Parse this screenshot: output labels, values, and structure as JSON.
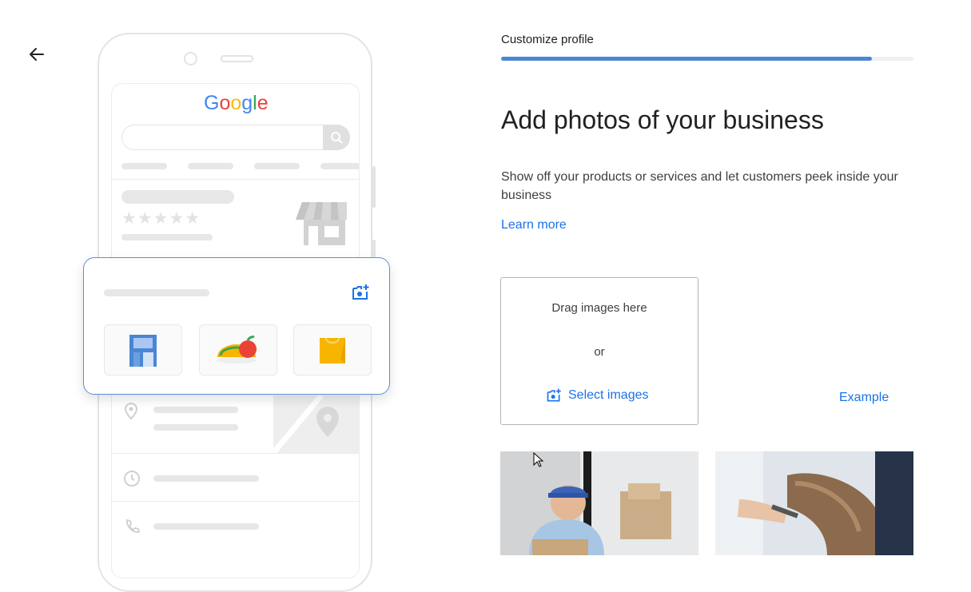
{
  "nav": {
    "back_icon": "arrow-left-icon"
  },
  "illustration": {
    "logo_letters": [
      {
        "ch": "G",
        "color": "#4285F4"
      },
      {
        "ch": "o",
        "color": "#EA4335"
      },
      {
        "ch": "o",
        "color": "#FBBC05"
      },
      {
        "ch": "g",
        "color": "#4285F4"
      },
      {
        "ch": "l",
        "color": "#34A853"
      },
      {
        "ch": "e",
        "color": "#EA4335"
      }
    ],
    "stars": "★★★★★"
  },
  "header": {
    "step_label": "Customize profile",
    "progress_fraction": 0.9
  },
  "main": {
    "title": "Add photos of your business",
    "description": "Show off your products or services and let customers peek inside your business",
    "learn_more": "Learn more"
  },
  "dropzone": {
    "drag_text": "Drag images here",
    "or_text": "or",
    "select_label": "Select images",
    "select_icon": "add-photo-icon"
  },
  "example_link": "Example",
  "colors": {
    "accent": "#1a73e8",
    "progress": "#4a86d4"
  }
}
